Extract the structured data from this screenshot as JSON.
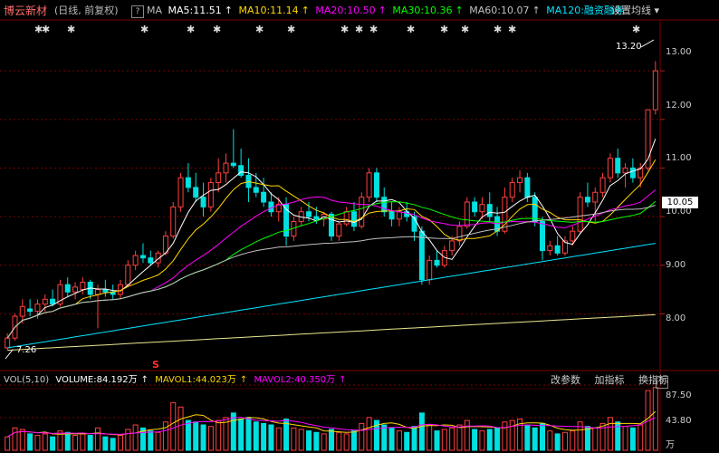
{
  "header": {
    "stock_name": "博云新材",
    "period": "(日线, 前复权)",
    "help_icon": "?",
    "ma_label": "MA",
    "settings": "设置均线 ▾",
    "ma_items": [
      {
        "label": "MA5:11.51",
        "arrow": "↑",
        "color": "#ffffff"
      },
      {
        "label": "MA10:11.14",
        "arrow": "↑",
        "color": "#ffd700"
      },
      {
        "label": "MA20:10.50",
        "arrow": "↑",
        "color": "#ff00ff"
      },
      {
        "label": "MA30:10.36",
        "arrow": "↑",
        "color": "#00ff00"
      },
      {
        "label": "MA60:10.07",
        "arrow": "↑",
        "color": "#c0c0c0"
      },
      {
        "label": "MA120:融资融券",
        "arrow": "",
        "color": "#00e5ff"
      }
    ]
  },
  "markers": {
    "bolt_glyph": "✱",
    "s_label": "S"
  },
  "annotations": {
    "high": "13.20",
    "low": "7.26"
  },
  "price_axis": {
    "ticks": [
      "13.00",
      "12.00",
      "11.00",
      "10.00",
      "9.00",
      "8.00"
    ],
    "current": "10.05"
  },
  "volume_panel": {
    "items": [
      {
        "label": "VOL(5,10)",
        "color": "#cccccc"
      },
      {
        "label": "VOLUME:84.192万",
        "color": "#ffffff"
      },
      {
        "label": "MAVOL1:44.023万",
        "color": "#ffd700"
      },
      {
        "label": "MAVOL2:40.350万",
        "color": "#ff00ff"
      }
    ],
    "arrows": [
      "↑",
      "↑",
      "↑"
    ],
    "buttons": [
      "改参数",
      "加指标",
      "换指标"
    ],
    "help_icon": "?",
    "axis_ticks": [
      "87.50",
      "43.80",
      "万"
    ]
  },
  "chart_data": {
    "type": "candlestick",
    "ylim": [
      7.0,
      13.6
    ],
    "volume_max": 87.5,
    "candles": [
      [
        7.3,
        7.6,
        7.26,
        7.5,
        18
      ],
      [
        7.5,
        8.0,
        7.45,
        7.95,
        30
      ],
      [
        7.95,
        8.3,
        7.8,
        8.15,
        28
      ],
      [
        8.1,
        8.3,
        7.95,
        8.05,
        22
      ],
      [
        8.05,
        8.3,
        7.9,
        8.2,
        20
      ],
      [
        8.2,
        8.4,
        8.05,
        8.3,
        22
      ],
      [
        8.3,
        8.5,
        8.15,
        8.2,
        18
      ],
      [
        8.2,
        8.7,
        8.15,
        8.6,
        26
      ],
      [
        8.6,
        8.75,
        8.35,
        8.45,
        24
      ],
      [
        8.45,
        8.65,
        8.3,
        8.55,
        20
      ],
      [
        8.5,
        8.75,
        8.4,
        8.65,
        22
      ],
      [
        8.65,
        8.7,
        8.3,
        8.4,
        20
      ],
      [
        8.4,
        8.6,
        7.7,
        8.5,
        30
      ],
      [
        8.5,
        8.7,
        8.35,
        8.45,
        18
      ],
      [
        8.45,
        8.6,
        8.3,
        8.4,
        16
      ],
      [
        8.4,
        8.7,
        8.3,
        8.6,
        20
      ],
      [
        8.6,
        9.1,
        8.55,
        9.0,
        28
      ],
      [
        9.0,
        9.3,
        8.9,
        9.2,
        34
      ],
      [
        9.2,
        9.45,
        9.05,
        9.15,
        30
      ],
      [
        9.15,
        9.3,
        9.0,
        9.05,
        26
      ],
      [
        9.05,
        9.3,
        8.95,
        9.25,
        24
      ],
      [
        9.25,
        9.7,
        9.2,
        9.6,
        38
      ],
      [
        9.6,
        10.3,
        9.55,
        10.2,
        64
      ],
      [
        10.2,
        10.9,
        10.1,
        10.8,
        58
      ],
      [
        10.8,
        11.1,
        10.5,
        10.6,
        40
      ],
      [
        10.6,
        10.9,
        10.3,
        10.4,
        38
      ],
      [
        10.4,
        10.7,
        10.0,
        10.2,
        34
      ],
      [
        10.2,
        10.8,
        10.1,
        10.7,
        32
      ],
      [
        10.7,
        11.2,
        10.5,
        10.9,
        40
      ],
      [
        10.9,
        11.3,
        10.7,
        11.1,
        44
      ],
      [
        11.1,
        11.8,
        11.0,
        11.05,
        50
      ],
      [
        11.05,
        11.4,
        10.8,
        10.85,
        42
      ],
      [
        10.85,
        11.2,
        10.3,
        10.6,
        44
      ],
      [
        10.6,
        10.9,
        10.4,
        10.5,
        38
      ],
      [
        10.5,
        10.8,
        10.2,
        10.3,
        36
      ],
      [
        10.3,
        10.5,
        10.0,
        10.1,
        34
      ],
      [
        10.1,
        10.4,
        9.9,
        10.25,
        30
      ],
      [
        10.25,
        10.4,
        9.4,
        9.6,
        42
      ],
      [
        9.6,
        10.0,
        9.5,
        9.9,
        30
      ],
      [
        9.9,
        10.2,
        9.8,
        10.1,
        28
      ],
      [
        10.1,
        10.3,
        9.9,
        10.0,
        26
      ],
      [
        10.0,
        10.2,
        9.85,
        9.95,
        24
      ],
      [
        9.95,
        10.1,
        9.8,
        10.05,
        22
      ],
      [
        10.05,
        10.1,
        9.5,
        9.6,
        28
      ],
      [
        9.6,
        9.9,
        9.5,
        9.85,
        24
      ],
      [
        9.85,
        10.2,
        9.8,
        10.1,
        22
      ],
      [
        10.1,
        10.3,
        9.7,
        9.8,
        26
      ],
      [
        9.8,
        10.5,
        9.75,
        10.4,
        36
      ],
      [
        10.4,
        11.0,
        10.3,
        10.9,
        44
      ],
      [
        10.9,
        11.0,
        10.3,
        10.4,
        40
      ],
      [
        10.4,
        10.6,
        10.0,
        10.1,
        34
      ],
      [
        10.1,
        10.3,
        9.8,
        9.95,
        30
      ],
      [
        9.95,
        10.2,
        9.8,
        10.1,
        26
      ],
      [
        10.1,
        10.3,
        9.9,
        10.0,
        24
      ],
      [
        10.0,
        10.1,
        9.5,
        9.7,
        32
      ],
      [
        9.7,
        9.8,
        8.6,
        8.7,
        50
      ],
      [
        8.7,
        9.2,
        8.6,
        9.1,
        34
      ],
      [
        9.1,
        9.3,
        8.95,
        9.0,
        26
      ],
      [
        9.0,
        9.4,
        8.95,
        9.3,
        28
      ],
      [
        9.3,
        9.6,
        9.2,
        9.5,
        30
      ],
      [
        9.5,
        9.9,
        9.4,
        9.8,
        34
      ],
      [
        9.8,
        10.4,
        9.75,
        10.3,
        40
      ],
      [
        10.3,
        10.4,
        10.0,
        10.1,
        28
      ],
      [
        10.1,
        10.4,
        9.95,
        10.25,
        26
      ],
      [
        10.25,
        10.5,
        9.9,
        10.0,
        28
      ],
      [
        10.0,
        10.2,
        9.6,
        9.7,
        30
      ],
      [
        9.7,
        10.6,
        9.65,
        10.4,
        38
      ],
      [
        10.4,
        10.8,
        10.3,
        10.7,
        40
      ],
      [
        10.7,
        10.95,
        10.5,
        10.8,
        42
      ],
      [
        10.8,
        10.9,
        10.3,
        10.4,
        34
      ],
      [
        10.4,
        10.5,
        9.8,
        9.9,
        30
      ],
      [
        9.9,
        10.0,
        9.1,
        9.3,
        36
      ],
      [
        9.3,
        9.5,
        9.2,
        9.4,
        26
      ],
      [
        9.4,
        9.6,
        9.2,
        9.25,
        22
      ],
      [
        9.25,
        9.6,
        9.2,
        9.5,
        24
      ],
      [
        9.5,
        9.8,
        9.4,
        9.7,
        26
      ],
      [
        9.7,
        10.5,
        9.65,
        10.4,
        38
      ],
      [
        10.4,
        10.7,
        10.2,
        10.3,
        32
      ],
      [
        10.3,
        10.6,
        9.9,
        10.5,
        30
      ],
      [
        10.5,
        10.9,
        10.4,
        10.8,
        36
      ],
      [
        10.8,
        11.3,
        10.7,
        11.2,
        44
      ],
      [
        11.2,
        11.4,
        10.8,
        10.9,
        38
      ],
      [
        10.9,
        11.1,
        10.6,
        11.0,
        32
      ],
      [
        11.0,
        11.2,
        10.7,
        10.8,
        30
      ],
      [
        10.8,
        11.1,
        10.6,
        11.0,
        34
      ],
      [
        11.0,
        12.2,
        10.95,
        12.2,
        80
      ],
      [
        12.2,
        13.2,
        12.1,
        13.0,
        84.2
      ]
    ],
    "vol_plot_top": 65
  }
}
